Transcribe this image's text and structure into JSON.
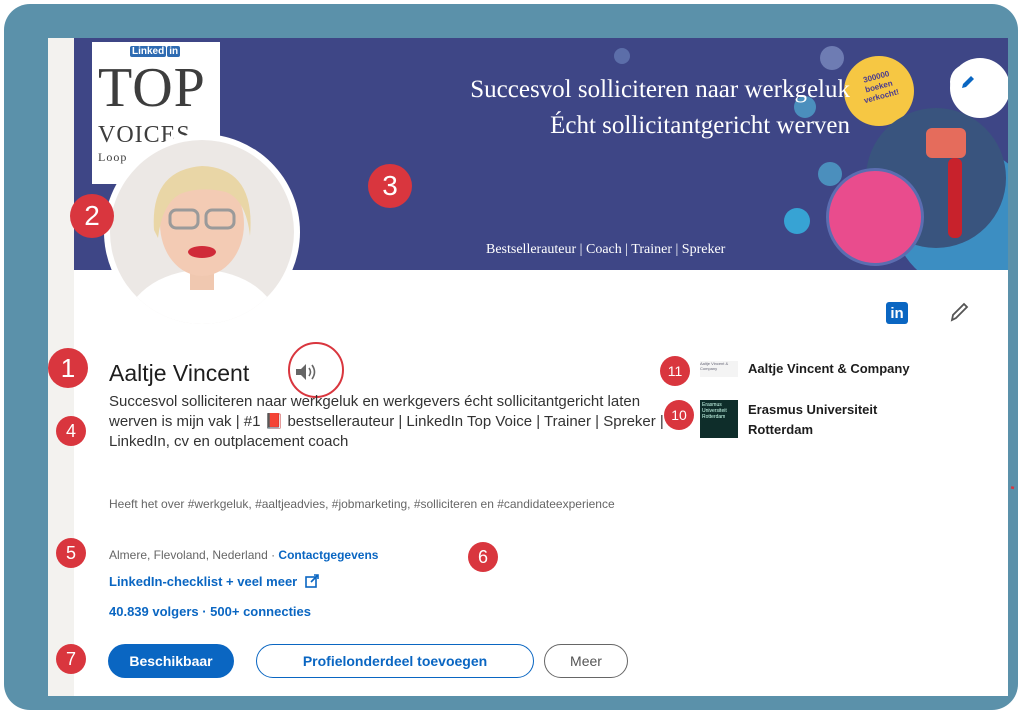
{
  "banner": {
    "line1": "Succesvol solliciteren naar werkgeluk",
    "line2": "Écht sollicitantgericht werven",
    "tagline": "Bestsellerauteur | Coach | Trainer | Spreker",
    "sticker": "300000 boeken verkocht!",
    "topvoices": {
      "brand": "Linked",
      "brand_in": "in",
      "top": "TOP",
      "voices": "VOICES",
      "sub": "Loop"
    }
  },
  "profile": {
    "name": "Aaltje Vincent",
    "headline": "Succesvol solliciteren naar werkgeluk en werkgevers écht sollicitantgericht laten werven is mijn vak | #1 📕 bestsellerauteur | LinkedIn Top Voice | Trainer | Spreker | LinkedIn, cv en outplacement coach",
    "hashtags": "Heeft het over #werkgeluk, #aaltjeadvies, #jobmarketing, #solliciteren en #candidateexperience",
    "location": "Almere, Flevoland, Nederland",
    "location_sep": " · ",
    "contact": "Contactgegevens",
    "checklist": "LinkedIn-checklist + veel meer",
    "followers": "40.839 volgers  · 500+ connecties"
  },
  "buttons": {
    "available": "Beschikbaar",
    "add_section": "Profielonderdeel toevoegen",
    "more": "Meer"
  },
  "companies": [
    {
      "name": "Aaltje Vincent & Company",
      "logo_text": "Aaltje Vincent & Company"
    },
    {
      "name": "Erasmus Universiteit Rotterdam",
      "logo_text": "Erasmus Universiteit Rotterdam"
    }
  ],
  "annotations": {
    "b1": "1",
    "b2": "2",
    "b3": "3",
    "b4": "4",
    "b5": "5",
    "b6": "6",
    "b7": "7",
    "b10": "10",
    "b11": "11"
  },
  "colors": {
    "frame": "#5b91aa",
    "banner": "#3e4686",
    "accent": "#0a66c2",
    "badge": "#d9363e"
  }
}
